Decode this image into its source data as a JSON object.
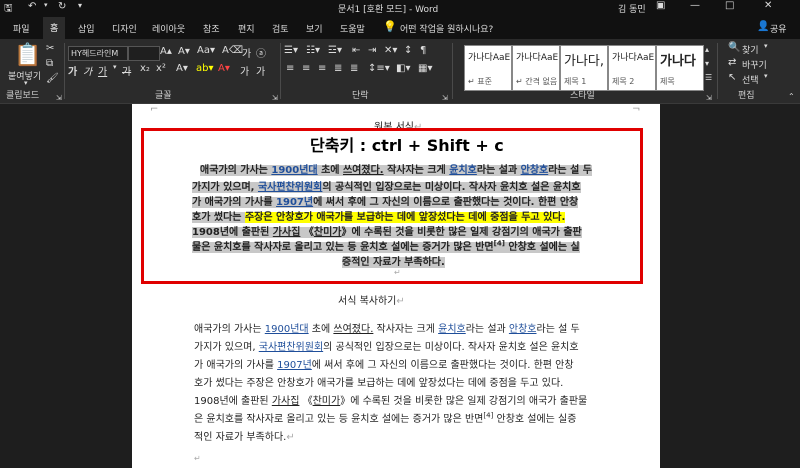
{
  "titlebar": {
    "doc_title": "문서1 [호환 모드] - Word",
    "user": "김 동민"
  },
  "menu": {
    "file": "파일",
    "home": "홈",
    "insert": "삽입",
    "design": "디자인",
    "layout": "레이아웃",
    "references": "참조",
    "mailings": "편지",
    "review": "검토",
    "view": "보기",
    "help": "도움말",
    "tellme": "어떤 작업을 원하시나요?",
    "share": "공유"
  },
  "ribbon": {
    "paste": "붙여넣기",
    "font_name": "HY헤드라인M",
    "styles": [
      {
        "preview": "가나다AaE",
        "name": "↵ 표준"
      },
      {
        "preview": "가나다AaE",
        "name": "↵ 간격 없음"
      },
      {
        "preview": "가나다,",
        "name": "제목 1"
      },
      {
        "preview": "가나다AaE",
        "name": "제목 2"
      },
      {
        "preview": "가나다",
        "name": "제목"
      }
    ],
    "find": "찾기",
    "replace": "바꾸기",
    "select": "선택",
    "groups": {
      "clipboard": "클립보드",
      "font": "글꼴",
      "paragraph": "단락",
      "style": "스타일",
      "editing": "편집"
    }
  },
  "document": {
    "heading1": "원본 서식",
    "shortcut": "단축키 : ctrl + Shift + c",
    "sel": {
      "l1": [
        "애국가의 가사는 ",
        "1900년대",
        " 초에 ",
        "쓰여졌다.",
        " 작사자는 크게 ",
        "윤치호",
        "라는 설과 ",
        "안창호",
        "라는 설 두"
      ],
      "l2": [
        "가지가 있으며, ",
        "국사편찬위원회",
        "의 공식적인 입장으로는 미상이다. 작사자 윤치호 설은 윤치호"
      ],
      "l3": [
        "가 애국가의 가사를 ",
        "1907년",
        "에 써서 후에 그 자신의 이름으로 출판했다는 것이다. 한편 안창"
      ],
      "l4": [
        "호가 썼다는 ",
        "주장은 안창호가 애국가를 보급하는 데에 앞장섰다는 데에 중점을 두고 있다."
      ],
      "l5": [
        "1908년에 출판된 ",
        "가사집",
        " 《",
        "찬미가",
        "》에 수록된 것을 비롯한 많은 일제 강점기의 애국가 출판"
      ],
      "l6": [
        "물은 윤치호를 작사자로 올리고 있는 등 윤치호 설에는 증거가 많은 반면",
        "[4]",
        " 안창호 설에는 실"
      ],
      "l7": "증적인 자료가 부족하다."
    },
    "heading2": "서식 복사하기",
    "plain": {
      "l1": [
        "애국가의 가사는 ",
        "1900년대",
        " 초에 ",
        "쓰여졌다.",
        " 작사자는 크게 ",
        "윤치호",
        "라는 설과 ",
        "안창호",
        "라는 설 두"
      ],
      "l2": [
        "가지가 있으며, ",
        "국사편찬위원회",
        "의 공식적인 입장으로는 미상이다. 작사자 윤치호 설은 윤치호"
      ],
      "l3": [
        "가 애국가의 가사를 ",
        "1907년",
        "에 써서 후에 그 자신의 이름으로 출판했다는 것이다. 한편 안창"
      ],
      "l4": "호가 썼다는 주장은 안창호가 애국가를 보급하는 데에 앞장섰다는 데에 중점을 두고 있다.",
      "l5": [
        "1908년에 출판된 ",
        "가사집",
        " 《",
        "찬미가",
        "》에 수록된 것을 비롯한 많은 일제 강점기의 애국가 출판물"
      ],
      "l6": [
        "은 윤치호를 작사자로 올리고 있는 등 윤치호 설에는 증거가 많은 반면",
        "[4]",
        " 안창호 설에는 실증"
      ],
      "l7": "적인 자료가 부족하다."
    }
  },
  "colors": {
    "accent_red": "#e00000",
    "highlight_yellow": "#ffff00",
    "selection_gray": "#c8c8c8",
    "link_blue": "#1f4e9a"
  }
}
